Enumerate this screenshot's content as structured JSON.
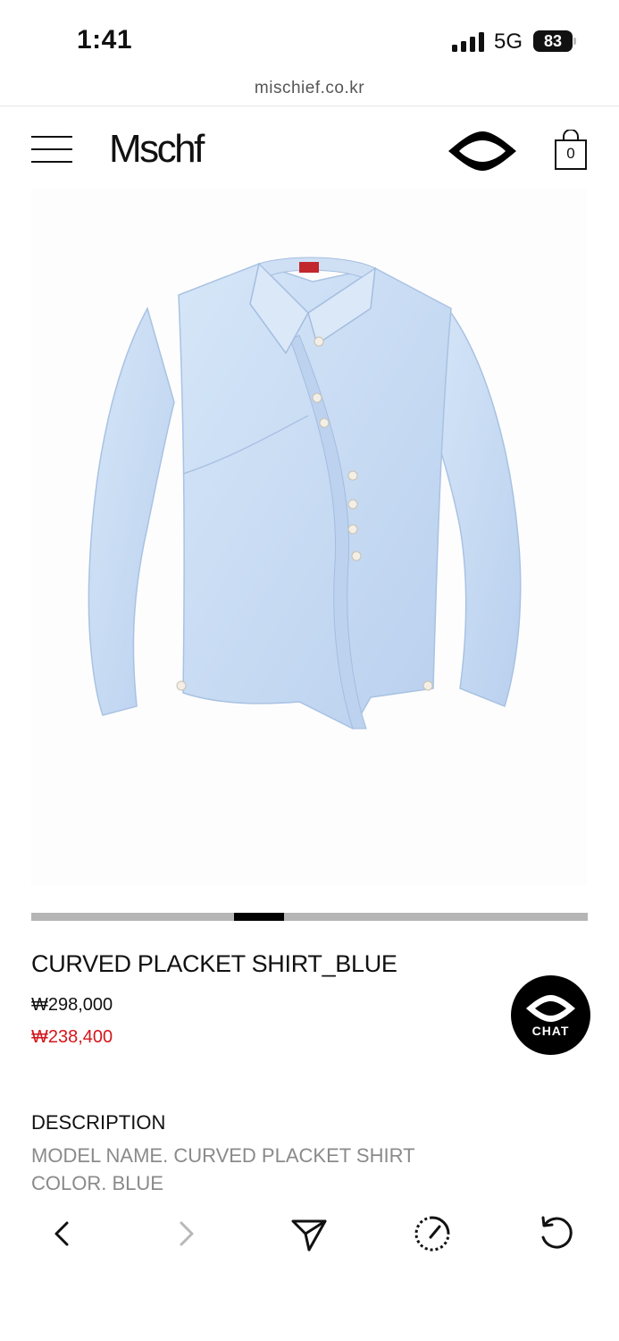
{
  "status_bar": {
    "time": "1:41",
    "network": "5G",
    "battery": "83"
  },
  "browser": {
    "url": "mischief.co.kr"
  },
  "header": {
    "logo": "Mschf",
    "cart_count": "0"
  },
  "product": {
    "image_icon": "blue-shirt-photo",
    "title": "CURVED PLACKET SHIRT_BLUE",
    "price_original": "₩298,000",
    "price_sale": "₩238,400",
    "slide_position": 0.4
  },
  "chat": {
    "label": "CHAT"
  },
  "description": {
    "heading": "DESCRIPTION",
    "lines": [
      "MODEL NAME. CURVED PLACKET SHIRT",
      "COLOR. BLUE"
    ]
  },
  "toolbar": {
    "icons": [
      "back-icon",
      "forward-icon",
      "share-icon",
      "speed-icon",
      "reload-icon"
    ]
  },
  "colors": {
    "sale": "#d4161d",
    "shirt": "#c9dcf3",
    "slider_track": "#b5b5b5"
  }
}
